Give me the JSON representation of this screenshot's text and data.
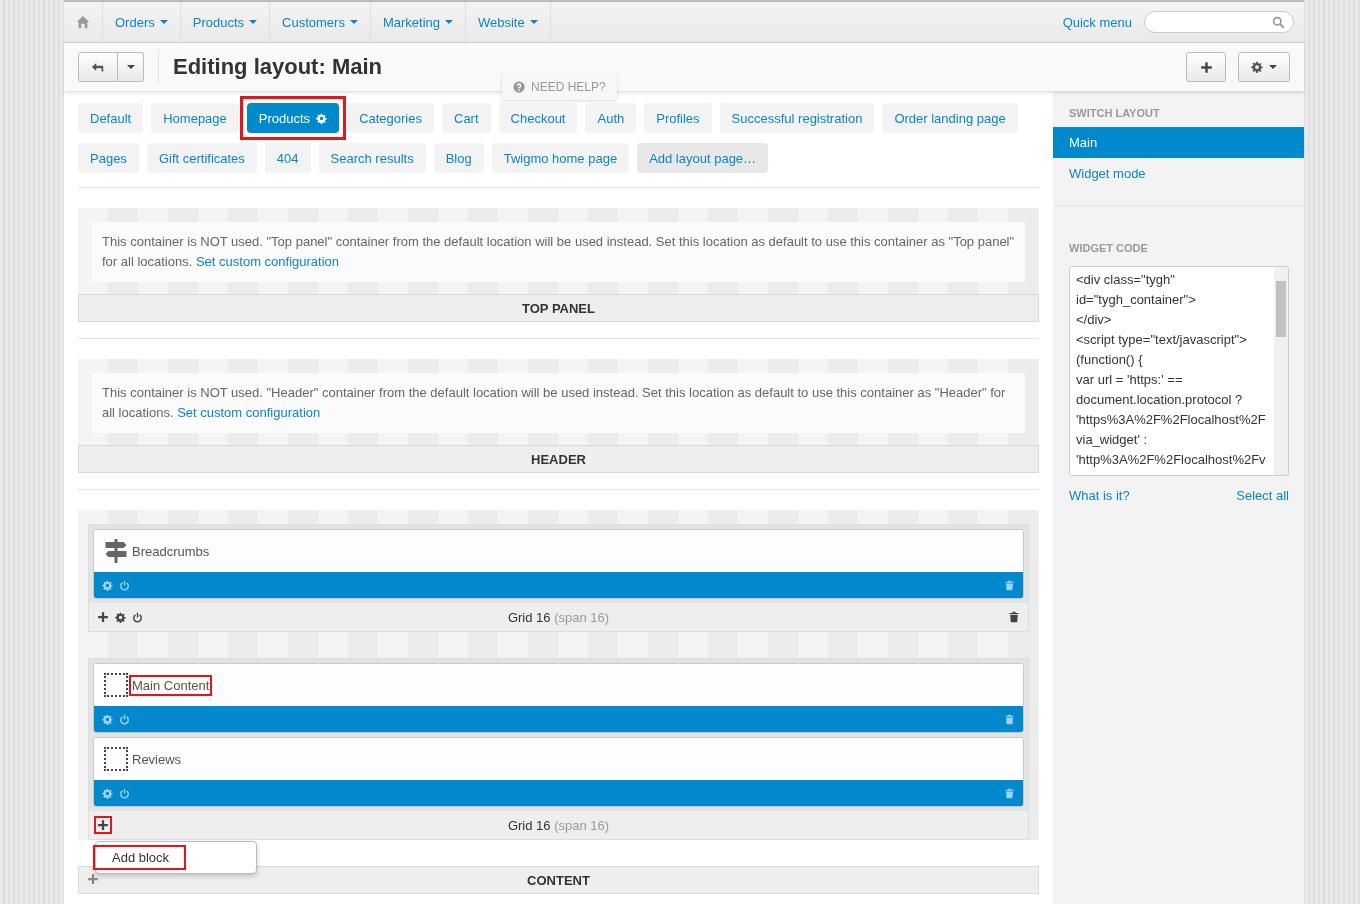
{
  "nav": {
    "items": [
      {
        "kind": "home"
      },
      {
        "kind": "menu",
        "label": "Orders"
      },
      {
        "kind": "menu",
        "label": "Products"
      },
      {
        "kind": "menu",
        "label": "Customers"
      },
      {
        "kind": "menu",
        "label": "Marketing"
      },
      {
        "kind": "menu",
        "label": "Website"
      }
    ],
    "quick_menu": "Quick menu"
  },
  "toolbar": {
    "title": "Editing layout: Main"
  },
  "need_help": "NEED HELP?",
  "layout_tabs": [
    {
      "label": "Default",
      "selected": false,
      "highlighted": false
    },
    {
      "label": "Homepage",
      "selected": false,
      "highlighted": false
    },
    {
      "label": "Products",
      "selected": true,
      "highlighted": true
    },
    {
      "label": "Categories",
      "selected": false,
      "highlighted": false
    },
    {
      "label": "Cart",
      "selected": false,
      "highlighted": false
    },
    {
      "label": "Checkout",
      "selected": false,
      "highlighted": false
    },
    {
      "label": "Auth",
      "selected": false,
      "highlighted": false
    },
    {
      "label": "Profiles",
      "selected": false,
      "highlighted": false
    },
    {
      "label": "Successful registration",
      "selected": false,
      "highlighted": false
    },
    {
      "label": "Order landing page",
      "selected": false,
      "highlighted": false
    },
    {
      "label": "Pages",
      "selected": false,
      "highlighted": false
    },
    {
      "label": "Gift certificates",
      "selected": false,
      "highlighted": false
    },
    {
      "label": "404",
      "selected": false,
      "highlighted": false
    },
    {
      "label": "Search results",
      "selected": false,
      "highlighted": false
    },
    {
      "label": "Blog",
      "selected": false,
      "highlighted": false
    },
    {
      "label": "Twigmo home page",
      "selected": false,
      "highlighted": false
    },
    {
      "label": "Add layout page…",
      "selected": false,
      "highlighted": false,
      "kind": "add"
    }
  ],
  "containers": [
    {
      "kind": "notice",
      "message": "This container is NOT used. \"Top panel\" container from the default location will be used instead. Set this location as default to use this container as \"Top panel\" for all locations.",
      "link": "Set custom configuration",
      "title": "TOP PANEL"
    },
    {
      "kind": "notice",
      "message": "This container is NOT used. \"Header\" container from the default location will be used instead. Set this location as default to use this container as \"Header\" for all locations.",
      "link": "Set custom configuration",
      "title": "HEADER"
    },
    {
      "kind": "grids",
      "title": "CONTENT",
      "grids": [
        {
          "blocks": [
            {
              "kind": "signpost",
              "name": "Breadcrumbs",
              "highlighted": false
            }
          ],
          "label": "Grid 16",
          "span": "(span 16)",
          "controls": true,
          "add_highlighted": false
        },
        {
          "blocks": [
            {
              "kind": "empty",
              "name": "Main Content",
              "highlighted": true
            },
            {
              "kind": "empty",
              "name": "Reviews",
              "highlighted": false
            }
          ],
          "label": "Grid 16",
          "span": "(span 16)",
          "controls": false,
          "add_highlighted": true,
          "menu": [
            {
              "label": "Add block",
              "highlighted": true
            }
          ]
        }
      ]
    }
  ],
  "sidebar": {
    "switch_heading": "SWITCH LAYOUT",
    "layouts": [
      {
        "label": "Main",
        "selected": true
      },
      {
        "label": "Widget mode",
        "selected": false
      }
    ],
    "code_heading": "WIDGET CODE",
    "code_lines": [
      "<div class=\"tygh\"",
      "id=\"tygh_container\">",
      "</div>",
      "<script type=\"text/javascript\">",
      "(function() {",
      "var url = 'https:' ==",
      "document.location.protocol ?",
      "'https%3A%2F%2Flocalhost%2F",
      "via_widget' :",
      "'http%3A%2F%2Flocalhost%2Fv"
    ],
    "links": [
      "What is it?",
      "Select all"
    ]
  }
}
